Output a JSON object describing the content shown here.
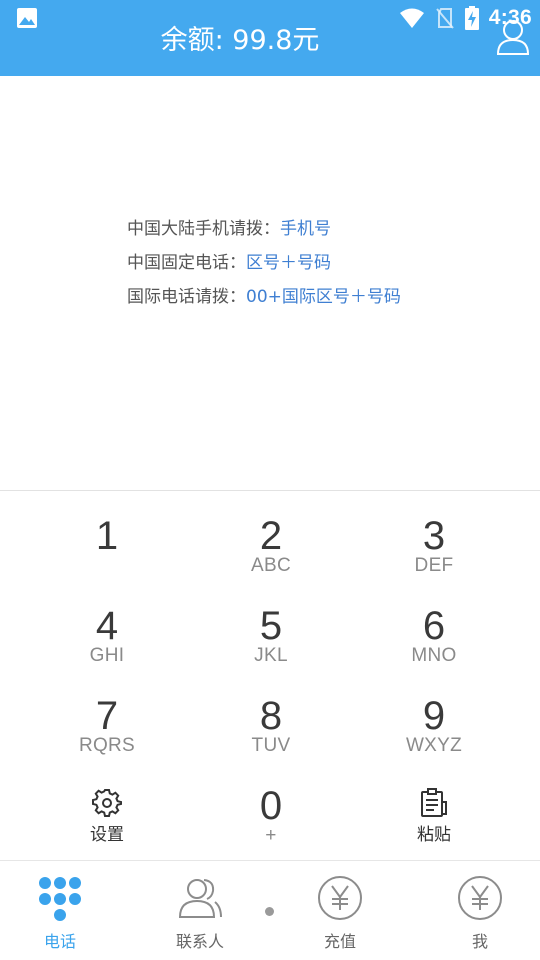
{
  "status_bar": {
    "time": "4:36",
    "icons": [
      "image-icon",
      "wifi-icon",
      "no-sim-icon",
      "battery-charging-icon"
    ]
  },
  "header": {
    "balance": "余额: 99.8元",
    "profile_icon": "person-outline-icon",
    "color": "#44a9ef"
  },
  "instructions": [
    {
      "label": "中国大陆手机请拨：",
      "value": "手机号"
    },
    {
      "label": "中国固定电话：",
      "value": "区号＋号码"
    },
    {
      "label": "国际电话请拨：",
      "value": "00+国际区号＋号码"
    }
  ],
  "keypad": {
    "keys": [
      {
        "digit": "1",
        "letters": ""
      },
      {
        "digit": "2",
        "letters": "ABC"
      },
      {
        "digit": "3",
        "letters": "DEF"
      },
      {
        "digit": "4",
        "letters": "GHI"
      },
      {
        "digit": "5",
        "letters": "JKL"
      },
      {
        "digit": "6",
        "letters": "MNO"
      },
      {
        "digit": "7",
        "letters": "RQRS"
      },
      {
        "digit": "8",
        "letters": "TUV"
      },
      {
        "digit": "9",
        "letters": "WXYZ"
      }
    ],
    "settings_label": "设置",
    "zero": {
      "digit": "0",
      "letters": "+"
    },
    "paste_label": "粘贴"
  },
  "bottom_nav": {
    "items": [
      {
        "label": "电话",
        "icon": "dialpad-icon",
        "active": true
      },
      {
        "label": "联系人",
        "icon": "contacts-icon",
        "active": false
      },
      {
        "label": "充值",
        "icon": "yuan-circle-icon",
        "active": false
      },
      {
        "label": "我",
        "icon": "yuan-circle-icon",
        "active": false
      }
    ],
    "active_color": "#3aa3ec"
  }
}
